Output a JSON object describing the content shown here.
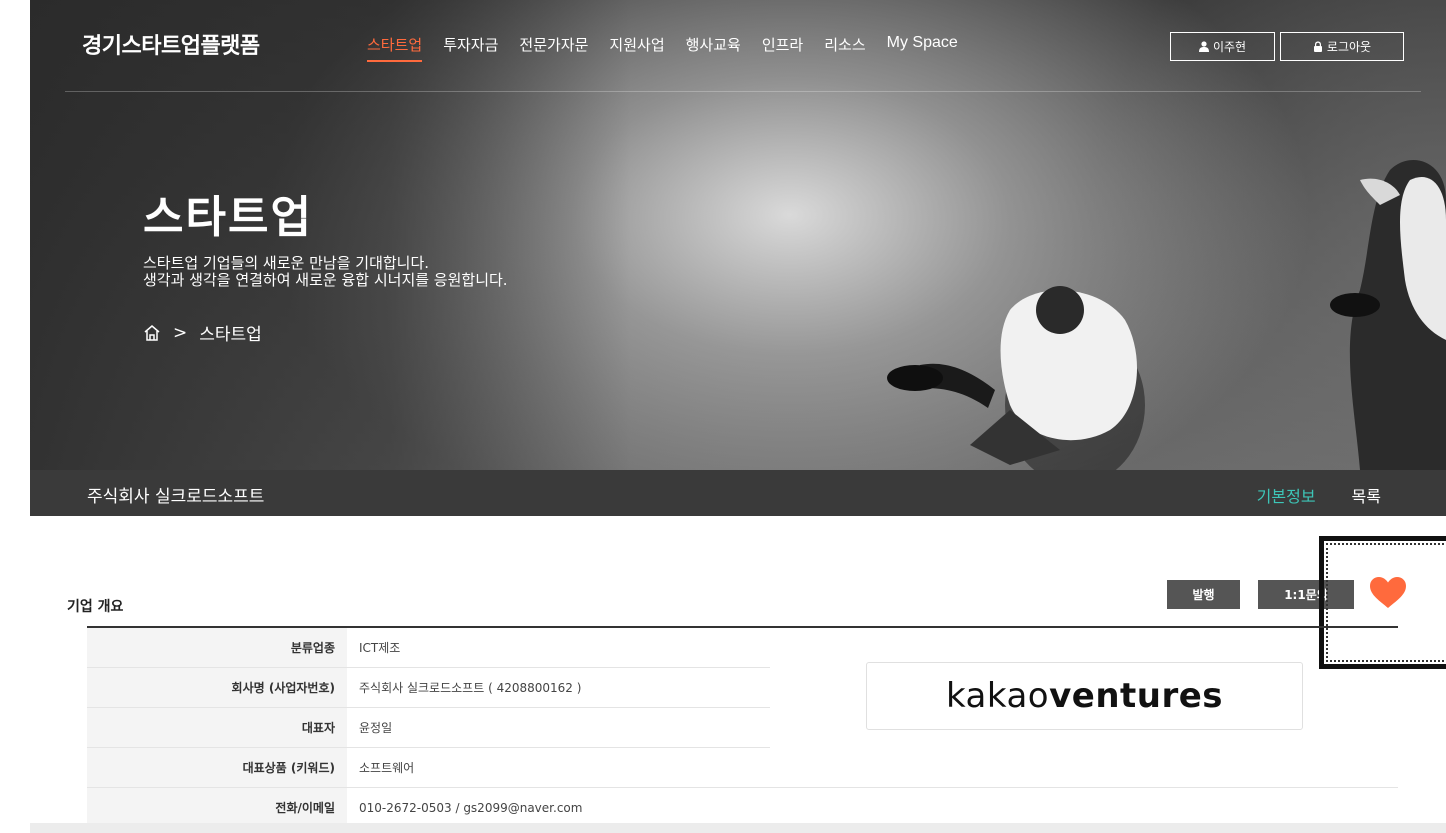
{
  "header": {
    "logo": "경기스타트업플랫폼",
    "menu": [
      {
        "label": "스타트업",
        "active": true
      },
      {
        "label": "투자자금",
        "active": false
      },
      {
        "label": "전문가자문",
        "active": false
      },
      {
        "label": "지원사업",
        "active": false
      },
      {
        "label": "행사교육",
        "active": false
      },
      {
        "label": "인프라",
        "active": false
      },
      {
        "label": "리소스",
        "active": false
      },
      {
        "label": "My Space",
        "active": false
      }
    ],
    "user_label": "이주현",
    "logout_label": "로그아웃"
  },
  "hero": {
    "title": "스타트업",
    "desc_line1": "스타트업 기업들의 새로운 만남을 기대합니다.",
    "desc_line2": "생각과 생각을 연결하여 새로운 융합 시너지를 응원합니다.",
    "breadcrumb_sep": ">",
    "breadcrumb_current": "스타트업"
  },
  "subbar": {
    "company_name": "주식회사 실크로드소프트",
    "tabs": [
      {
        "label": "기본정보",
        "active": true
      },
      {
        "label": "목록",
        "active": false
      }
    ]
  },
  "overview": {
    "title": "기업 개요",
    "issue_button": "발행",
    "inquiry_button": "1:1문의",
    "rows": [
      {
        "label": "분류업종",
        "value": "ICT제조"
      },
      {
        "label": "회사명 (사업자번호)",
        "value": "주식회사 실크로드소프트 ( 4208800162 )"
      },
      {
        "label": "대표자",
        "value": "윤정일"
      },
      {
        "label": "대표상품 (키워드)",
        "value": "소프트웨어"
      },
      {
        "label": "전화/이메일",
        "value": "010-2672-0503 / gs2099@naver.com"
      }
    ],
    "logo_text_part1": "kakao",
    "logo_text_part2": "ventures"
  },
  "colors": {
    "accent": "#ff6a3d",
    "active_tab": "#3dc6b8",
    "subbar_bg": "#3a3a3a",
    "button_bg": "#555555"
  }
}
